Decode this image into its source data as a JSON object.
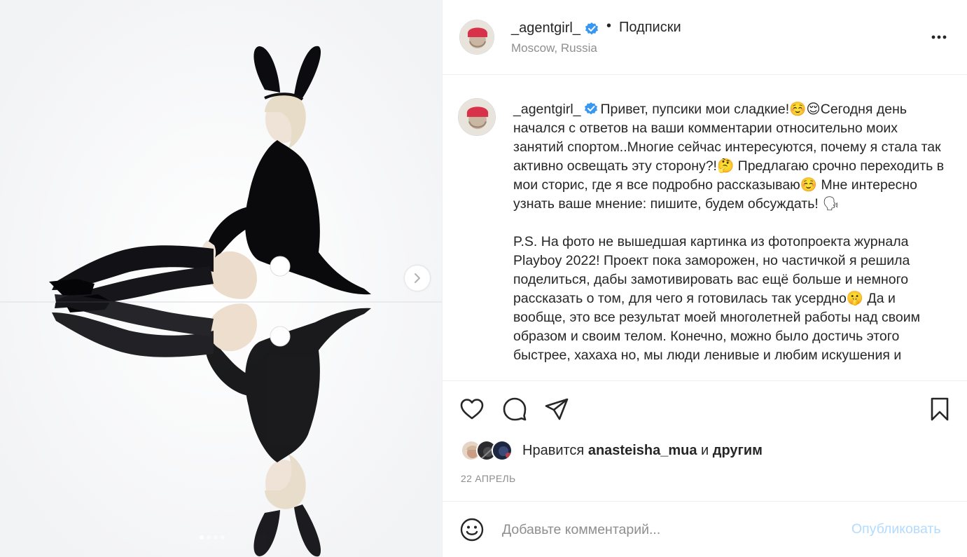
{
  "post": {
    "username": "_agentgirl_",
    "follow_label": "Подписки",
    "separator": "•",
    "location": "Moscow, Russia"
  },
  "caption": {
    "username": "_agentgirl_",
    "paragraph_1": "Привет, пупсики мои сладкие!☺️😌Сегодня день начался с ответов на ваши комментарии относительно моих занятий спортом..Многие сейчас интересуются, почему я стала так активно освещать эту сторону?!🤔 Предлагаю срочно переходить в мои сторис, где я все подробно рассказываю☺️ Мне интересно узнать ваше мнение: пишите, будем обсуждать! 🗣",
    "paragraph_2": "P.S. На фото не вышедшая картинка из фотопроекта журнала Playboy 2022! Проект пока заморожен, но частичкой я решила поделиться, дабы замотивировать вас ещё больше и немного рассказать о том, для чего я готовилась так усердно🤫 Да и вообще, это все результат моей многолетней работы над своим образом и своим телом. Конечно, можно было достичь этого быстрее, хахаха но, мы люди ленивые и любим искушения и"
  },
  "likes": {
    "prefix": "Нравится",
    "user": "anasteisha_mua",
    "conjunction": "и",
    "others": "другим"
  },
  "date": "22 АПРЕЛЬ",
  "comment": {
    "placeholder": "Добавьте комментарий...",
    "publish_label": "Опубликовать"
  },
  "icons": {
    "verified": "verified-badge-icon",
    "more": "more-options-icon",
    "like": "heart-icon",
    "comment": "comment-icon",
    "share": "share-icon",
    "save": "bookmark-icon",
    "emoji": "emoji-icon",
    "next": "chevron-right-icon"
  },
  "colors": {
    "verified": "#3897f0",
    "publish_disabled": "#b3dbff",
    "secondary_text": "#8e8e8e",
    "primary_text": "#262626",
    "divider": "#efefef"
  },
  "carousel": {
    "slide_count": 4,
    "current_slide": 1
  }
}
